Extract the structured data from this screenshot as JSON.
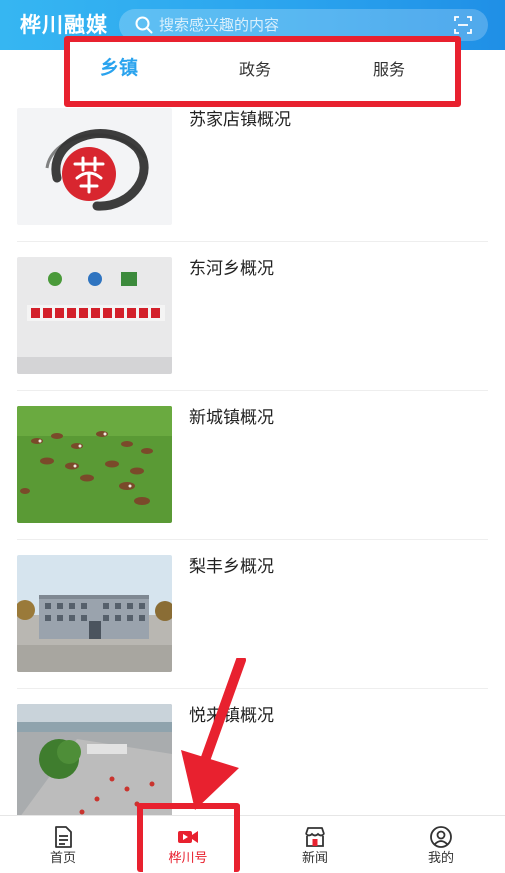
{
  "header": {
    "app_title": "桦川融媒",
    "search_placeholder": "搜索感兴趣的内容"
  },
  "tabs": [
    {
      "label": "乡镇",
      "active": true
    },
    {
      "label": "政务",
      "active": false
    },
    {
      "label": "服务",
      "active": false
    }
  ],
  "list": [
    {
      "title": "苏家店镇概况",
      "image": "su-seal-image"
    },
    {
      "title": "东河乡概况",
      "image": "center-sign-image"
    },
    {
      "title": "新城镇概况",
      "image": "cattle-field-image"
    },
    {
      "title": "梨丰乡概况",
      "image": "government-building-image"
    },
    {
      "title": "悦来镇概况",
      "image": "plaza-aerial-image"
    }
  ],
  "bottom_nav": [
    {
      "label": "首页",
      "icon": "document-icon",
      "active": false
    },
    {
      "label": "桦川号",
      "icon": "video-camera-icon",
      "active": true
    },
    {
      "label": "新闻",
      "icon": "store-icon",
      "active": false
    },
    {
      "label": "我的",
      "icon": "user-icon",
      "active": false
    }
  ],
  "colors": {
    "brand": "#2aa3ee",
    "annotation_red": "#e8212f"
  }
}
